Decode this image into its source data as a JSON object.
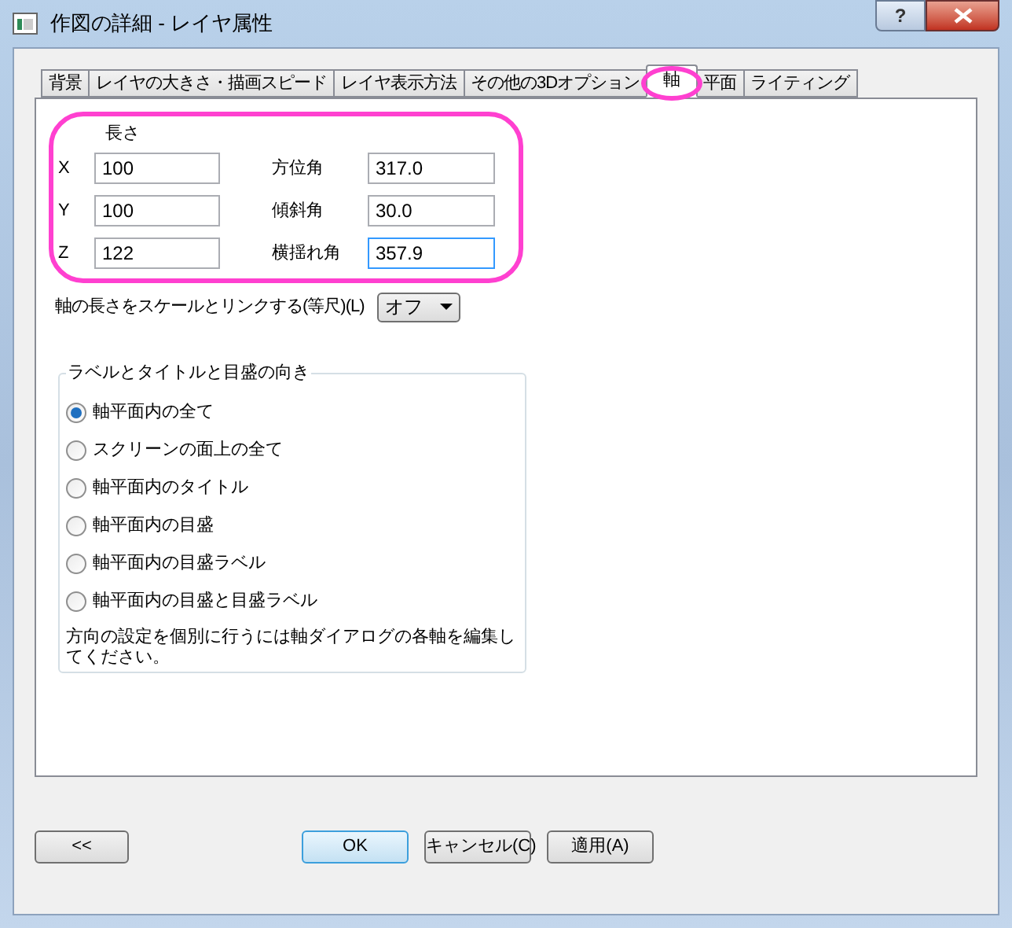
{
  "window": {
    "title": "作図の詳細 - レイヤ属性",
    "help_button": "?"
  },
  "tabs": [
    {
      "label": "背景",
      "selected": false
    },
    {
      "label": "レイヤの大きさ・描画スピード",
      "selected": false
    },
    {
      "label": "レイヤ表示方法",
      "selected": false
    },
    {
      "label": "その他の3Dオプション",
      "selected": false
    },
    {
      "label": "軸",
      "selected": true
    },
    {
      "label": "平面",
      "selected": false
    },
    {
      "label": "ライティング",
      "selected": false
    }
  ],
  "length": {
    "heading": "長さ",
    "fields": [
      {
        "label": "X",
        "value": "100"
      },
      {
        "label": "Y",
        "value": "100"
      },
      {
        "label": "Z",
        "value": "122"
      }
    ]
  },
  "angles": [
    {
      "label": "方位角",
      "value": "317.0",
      "focused": false
    },
    {
      "label": "傾斜角",
      "value": "30.0",
      "focused": false
    },
    {
      "label": "横揺れ角",
      "value": "357.9",
      "focused": true
    }
  ],
  "link_scale": {
    "label": "軸の長さをスケールとリンクする(等尺)(L)",
    "value": "オフ"
  },
  "orientation": {
    "title": "ラベルとタイトルと目盛の向き",
    "options": [
      {
        "label": "軸平面内の全て",
        "selected": true
      },
      {
        "label": "スクリーンの面上の全て",
        "selected": false
      },
      {
        "label": "軸平面内のタイトル",
        "selected": false
      },
      {
        "label": "軸平面内の目盛",
        "selected": false
      },
      {
        "label": "軸平面内の目盛ラベル",
        "selected": false
      },
      {
        "label": "軸平面内の目盛と目盛ラベル",
        "selected": false
      }
    ],
    "note": "方向の設定を個別に行うには軸ダイアログの各軸を編集してください。"
  },
  "buttons": [
    {
      "label": "<<",
      "default": false
    },
    {
      "label": "OK",
      "default": true
    },
    {
      "label": "キャンセル(C)",
      "default": false
    },
    {
      "label": "適用(A)",
      "default": false
    }
  ]
}
